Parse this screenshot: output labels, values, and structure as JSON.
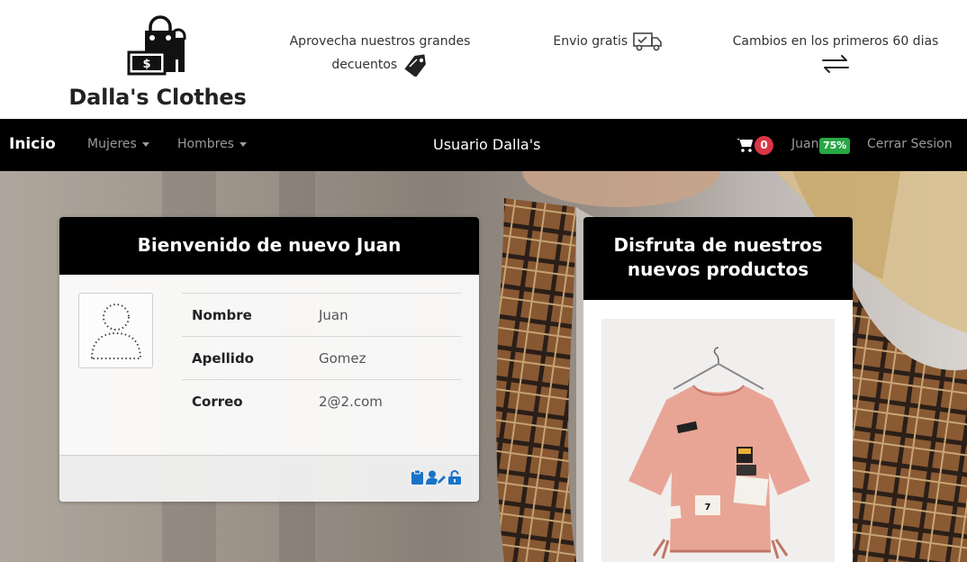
{
  "brand": {
    "name": "Dalla's Clothes",
    "logo_icon": "shopping-bag-money-icon"
  },
  "promos": {
    "deals": {
      "text": "Aprovecha nuestros grandes decuentos",
      "icon": "price-tag-icon"
    },
    "shipping": {
      "text": "Envio gratis",
      "icon": "delivery-truck-icon"
    },
    "returns": {
      "text": "Cambios en los primeros 60 dias",
      "icon": "exchange-arrows-icon"
    }
  },
  "navbar": {
    "home": "Inicio",
    "women": "Mujeres",
    "men": "Hombres",
    "center_title": "Usuario Dalla's",
    "cart_count": "0",
    "user_name": "Juan",
    "user_badge": "75%",
    "logout": "Cerrar Sesion"
  },
  "welcome_card": {
    "title": "Bienvenido de nuevo Juan",
    "rows": [
      {
        "label": "Nombre",
        "value": "Juan"
      },
      {
        "label": "Apellido",
        "value": "Gomez"
      },
      {
        "label": "Correo",
        "value": "2@2.com"
      }
    ],
    "footer_icons": [
      "clipboard-icon",
      "user-edit-icon",
      "unlock-icon"
    ]
  },
  "product_card": {
    "title": "Disfruta de nuestros nuevos productos",
    "image_icon": "pink-blouse-icon"
  },
  "colors": {
    "navbar_bg": "#000000",
    "cart_badge": "#dc3545",
    "user_badge": "#28a745",
    "footer_icon": "#1a73c8"
  }
}
